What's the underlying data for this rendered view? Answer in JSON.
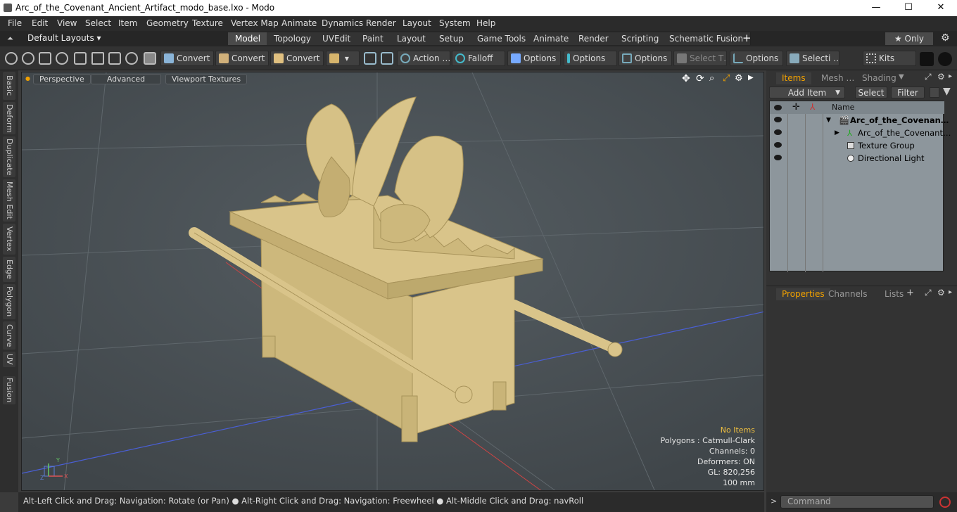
{
  "window": {
    "title": "Arc_of_the_Covenant_Ancient_Artifact_modo_base.lxo - Modo",
    "minimize": "—",
    "maximize": "☐",
    "close": "✕"
  },
  "menu": [
    "File",
    "Edit",
    "View",
    "Select",
    "Item",
    "Geometry",
    "Texture",
    "Vertex Map",
    "Animate",
    "Dynamics",
    "Render",
    "Layout",
    "System",
    "Help"
  ],
  "layouts": {
    "dropdown": "Default Layouts ▾",
    "tabs": [
      "Model",
      "Topology",
      "UVEdit",
      "Paint",
      "Layout",
      "Setup",
      "Game Tools",
      "Animate",
      "Render",
      "Scripting",
      "Schematic Fusion"
    ],
    "active": "Model",
    "add": "+",
    "only": "★  Only"
  },
  "toolbar": {
    "convert1": "Convert",
    "convert2": "Convert",
    "convert3": "Convert",
    "action": "Action …",
    "falloff": "Falloff",
    "options1": "Options",
    "options2": "Options",
    "options3": "Options",
    "select_t": "Select T…",
    "options4": "Options",
    "selecti": "Selecti …",
    "kits": "Kits"
  },
  "left_tabs": [
    "Basic",
    "Deform",
    "Duplicate",
    "Mesh Edit",
    "Vertex",
    "Edge",
    "Polygon",
    "Curve",
    "UV",
    "Fusion"
  ],
  "viewport": {
    "perspective": "Perspective",
    "advanced": "Advanced",
    "textures": "Viewport Textures",
    "info": {
      "selection": "No Items",
      "polygons": "Polygons : Catmull-Clark",
      "channels": "Channels: 0",
      "deformers": "Deformers: ON",
      "gl": "GL: 820,256",
      "scale": "100 mm"
    },
    "axis": {
      "x": "X",
      "y": "Y",
      "z": "Z"
    }
  },
  "status": "Alt-Left Click and Drag: Navigation: Rotate (or Pan) ● Alt-Right Click and Drag: Navigation: Freewheel ● Alt-Middle Click and Drag: navRoll",
  "items_panel": {
    "tabs": [
      "Items",
      "Mesh …",
      "Shading"
    ],
    "add_item": "Add Item",
    "select": "Select",
    "filter": "Filter",
    "col_name": "Name",
    "rows": [
      {
        "label": "Arc_of_the_Covenan…",
        "bold": true
      },
      {
        "label": "Arc_of_the_Covenant…"
      },
      {
        "label": "Texture Group"
      },
      {
        "label": "Directional Light"
      }
    ]
  },
  "props_panel": {
    "tabs": [
      "Properties",
      "Channels",
      "Lists"
    ],
    "add": "+"
  },
  "command": {
    "placeholder": "Command",
    "prompt": ">"
  },
  "colors": {
    "accent": "#f0a000",
    "model": "#d9c48a",
    "viewport": "#4b5257"
  }
}
